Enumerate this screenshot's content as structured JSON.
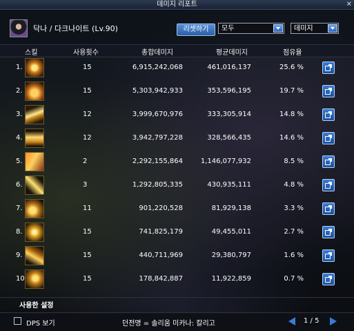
{
  "window": {
    "title": "데미지 리포트"
  },
  "header": {
    "character": "닥나 / 다크나이트 (Lv.90)",
    "reset_label": "리셋하기",
    "filter_target": "모두",
    "filter_metric": "데미지"
  },
  "columns": {
    "skill": "스킬",
    "count": "사용횟수",
    "total": "총합데미지",
    "avg": "평균데미지",
    "share": "점유율"
  },
  "rows": [
    {
      "idx": "1.",
      "count": "15",
      "total": "6,915,242,068",
      "avg": "461,016,137",
      "share": "25.6 %"
    },
    {
      "idx": "2.",
      "count": "15",
      "total": "5,303,942,933",
      "avg": "353,596,195",
      "share": "19.7 %"
    },
    {
      "idx": "3.",
      "count": "12",
      "total": "3,999,670,976",
      "avg": "333,305,914",
      "share": "14.8 %"
    },
    {
      "idx": "4.",
      "count": "12",
      "total": "3,942,797,228",
      "avg": "328,566,435",
      "share": "14.6 %"
    },
    {
      "idx": "5.",
      "count": "2",
      "total": "2,292,155,864",
      "avg": "1,146,077,932",
      "share": "8.5 %"
    },
    {
      "idx": "6.",
      "count": "3",
      "total": "1,292,805,335",
      "avg": "430,935,111",
      "share": "4.8 %"
    },
    {
      "idx": "7.",
      "count": "11",
      "total": "901,220,528",
      "avg": "81,929,138",
      "share": "3.3 %"
    },
    {
      "idx": "8.",
      "count": "15",
      "total": "741,825,179",
      "avg": "49,455,011",
      "share": "2.7 %"
    },
    {
      "idx": "9.",
      "count": "15",
      "total": "440,711,969",
      "avg": "29,380,797",
      "share": "1.6 %"
    },
    {
      "idx": "10.",
      "count": "15",
      "total": "178,842,887",
      "avg": "11,922,859",
      "share": "0.7 %"
    }
  ],
  "footer": {
    "settings": "사용한 설정",
    "dps_label": "DPS 보기",
    "dungeon": "던전명 = 솔리움 미카나: 칼리고",
    "page": "1 / 5"
  },
  "colors": {
    "accent": "#3a7cd6",
    "title_bar": "#2d3a52"
  }
}
